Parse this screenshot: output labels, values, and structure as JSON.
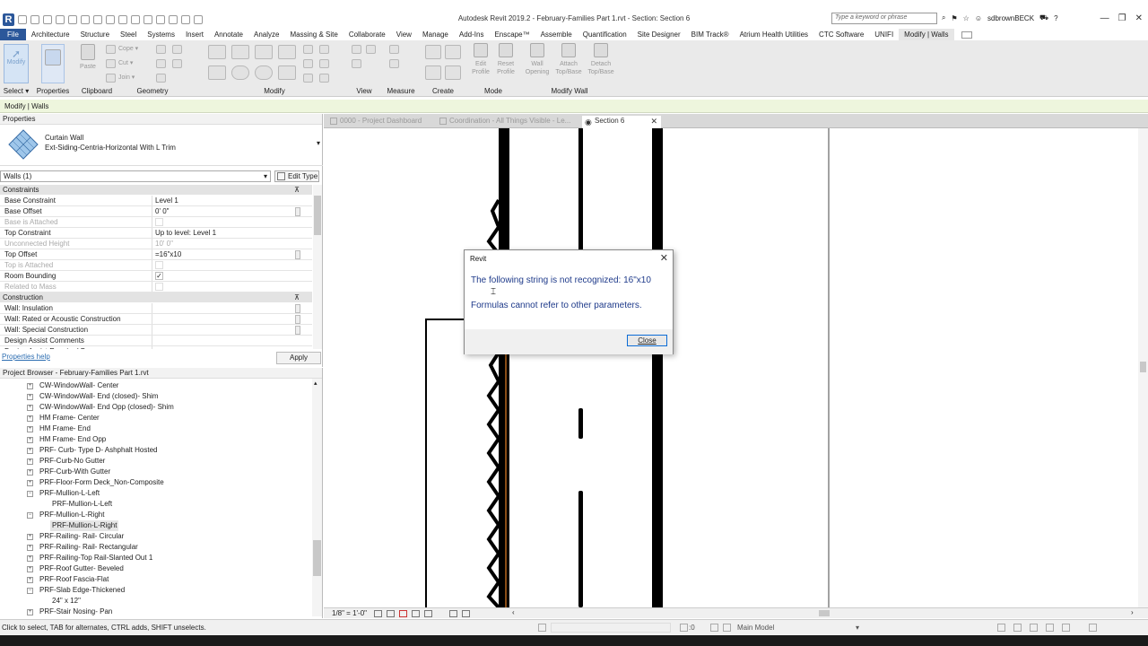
{
  "app": {
    "title": "Autodesk Revit 2019.2 - February-Families Part 1.rvt - Section: Section 6",
    "logo": "R",
    "search_placeholder": "Type a keyword or phrase",
    "user": "sdbrownBECK"
  },
  "menu": [
    "File",
    "Architecture",
    "Structure",
    "Steel",
    "Systems",
    "Insert",
    "Annotate",
    "Analyze",
    "Massing & Site",
    "Collaborate",
    "View",
    "Manage",
    "Add-Ins",
    "Enscape™",
    "Assemble",
    "Quantification",
    "Site Designer",
    "BIM Track®",
    "Atrium Health Utilities",
    "CTC Software",
    "UNIFI",
    "Modify | Walls"
  ],
  "ribbon": {
    "modify_button": "Modify",
    "select": "Select",
    "properties": "Properties",
    "paste": "Paste",
    "cope": "Cope",
    "cut": "Cut",
    "join": "Join",
    "clipboard": "Clipboard",
    "geometry": "Geometry",
    "modify": "Modify",
    "view": "View",
    "measure": "Measure",
    "create": "Create",
    "mode": "Mode",
    "modify_wall": "Modify Wall",
    "edit_profile": "Edit Profile",
    "reset_profile": "Reset Profile",
    "wall_opening": "Wall Opening",
    "attach_top_base": "Attach Top/Base",
    "detach_top_base": "Detach Top/Base"
  },
  "context_bar": "Modify | Walls",
  "properties": {
    "title": "Properties",
    "family": "Curtain Wall",
    "type": "Ext-Siding-Centria-Horizontal With L Trim",
    "instance_selector": "Walls (1)",
    "edit_type": "Edit Type",
    "groups": {
      "constraints": "Constraints",
      "construction": "Construction"
    },
    "toggle": "⊼",
    "rows": [
      {
        "k": "Base Constraint",
        "v": "Level 1"
      },
      {
        "k": "Base Offset",
        "v": "0'  0\""
      },
      {
        "k": "Base is Attached",
        "v": ""
      },
      {
        "k": "Top Constraint",
        "v": "Up to level: Level 1"
      },
      {
        "k": "Unconnected Height",
        "v": "10'  0\""
      },
      {
        "k": "Top Offset",
        "v": "=16\"x10"
      },
      {
        "k": "Top is Attached",
        "v": ""
      },
      {
        "k": "Room Bounding",
        "v": "✓"
      },
      {
        "k": "Related to Mass",
        "v": ""
      }
    ],
    "rows2": [
      {
        "k": "Wall: Insulation",
        "v": ""
      },
      {
        "k": "Wall: Rated or Acoustic Construction",
        "v": ""
      },
      {
        "k": "Wall: Special Construction",
        "v": ""
      },
      {
        "k": "Design Assist Comments",
        "v": ""
      },
      {
        "k": "Design Assist Required By",
        "v": ""
      }
    ],
    "help": "Properties help",
    "apply": "Apply"
  },
  "browser": {
    "title": "Project Browser - February-Families Part 1.rvt",
    "items": [
      {
        "t": "CW-WindowWall- Center",
        "l": 1,
        "e": "+"
      },
      {
        "t": "CW-WindowWall- End (closed)- Shim",
        "l": 1,
        "e": "+"
      },
      {
        "t": "CW-WindowWall- End Opp (closed)- Shim",
        "l": 1,
        "e": "+"
      },
      {
        "t": "HM Frame- Center",
        "l": 1,
        "e": "+"
      },
      {
        "t": "HM Frame- End",
        "l": 1,
        "e": "+"
      },
      {
        "t": "HM Frame- End Opp",
        "l": 1,
        "e": "+"
      },
      {
        "t": "PRF- Curb- Type D- Ashphalt Hosted",
        "l": 1,
        "e": "+"
      },
      {
        "t": "PRF-Curb-No Gutter",
        "l": 1,
        "e": "+"
      },
      {
        "t": "PRF-Curb-With Gutter",
        "l": 1,
        "e": "+"
      },
      {
        "t": "PRF-Floor-Form Deck_Non-Composite",
        "l": 1,
        "e": "+"
      },
      {
        "t": "PRF-Mullion-L-Left",
        "l": 1,
        "e": "−"
      },
      {
        "t": "PRF-Mullion-L-Left",
        "l": 2,
        "e": ""
      },
      {
        "t": "PRF-Mullion-L-Right",
        "l": 1,
        "e": "−"
      },
      {
        "t": "PRF-Mullion-L-Right",
        "l": 2,
        "e": "",
        "sel": true
      },
      {
        "t": "PRF-Railing- Rail- Circular",
        "l": 1,
        "e": "+"
      },
      {
        "t": "PRF-Railing- Rail- Rectangular",
        "l": 1,
        "e": "+"
      },
      {
        "t": "PRF-Railing-Top Rail-Slanted Out 1",
        "l": 1,
        "e": "+"
      },
      {
        "t": "PRF-Roof  Gutter- Beveled",
        "l": 1,
        "e": "+"
      },
      {
        "t": "PRF-Roof Fascia-Flat",
        "l": 1,
        "e": "+"
      },
      {
        "t": "PRF-Slab Edge-Thickened",
        "l": 1,
        "e": "−"
      },
      {
        "t": "24\" x 12\"",
        "l": 2,
        "e": ""
      },
      {
        "t": "PRF-Stair Nosing- Pan",
        "l": 1,
        "e": "+"
      }
    ]
  },
  "tabs": [
    {
      "label": "0000 - Project Dashboard",
      "active": false
    },
    {
      "label": "Coordination - All Things Visible - Le...",
      "active": false
    },
    {
      "label": "Section 6",
      "active": true
    }
  ],
  "viewbar": {
    "scale": "1/8\" = 1'-0\""
  },
  "status": {
    "hint": "Click to select, TAB for alternates, CTRL adds, SHIFT unselects.",
    "zero": ":0",
    "model": "Main Model"
  },
  "dialog": {
    "title": "Revit",
    "message": "The following string is not recognized:  16\"x10",
    "detail": "Formulas cannot refer to other parameters.",
    "close": "Close"
  },
  "icons": {
    "close": "✕",
    "minimize": "—",
    "restore": "❐",
    "dropdown": "▾",
    "expand": "+",
    "collapse": "−"
  },
  "colors": {
    "accent": "#2b579a",
    "context_bar": "#eef6dd",
    "dialog_text": "#1e3a8a"
  }
}
